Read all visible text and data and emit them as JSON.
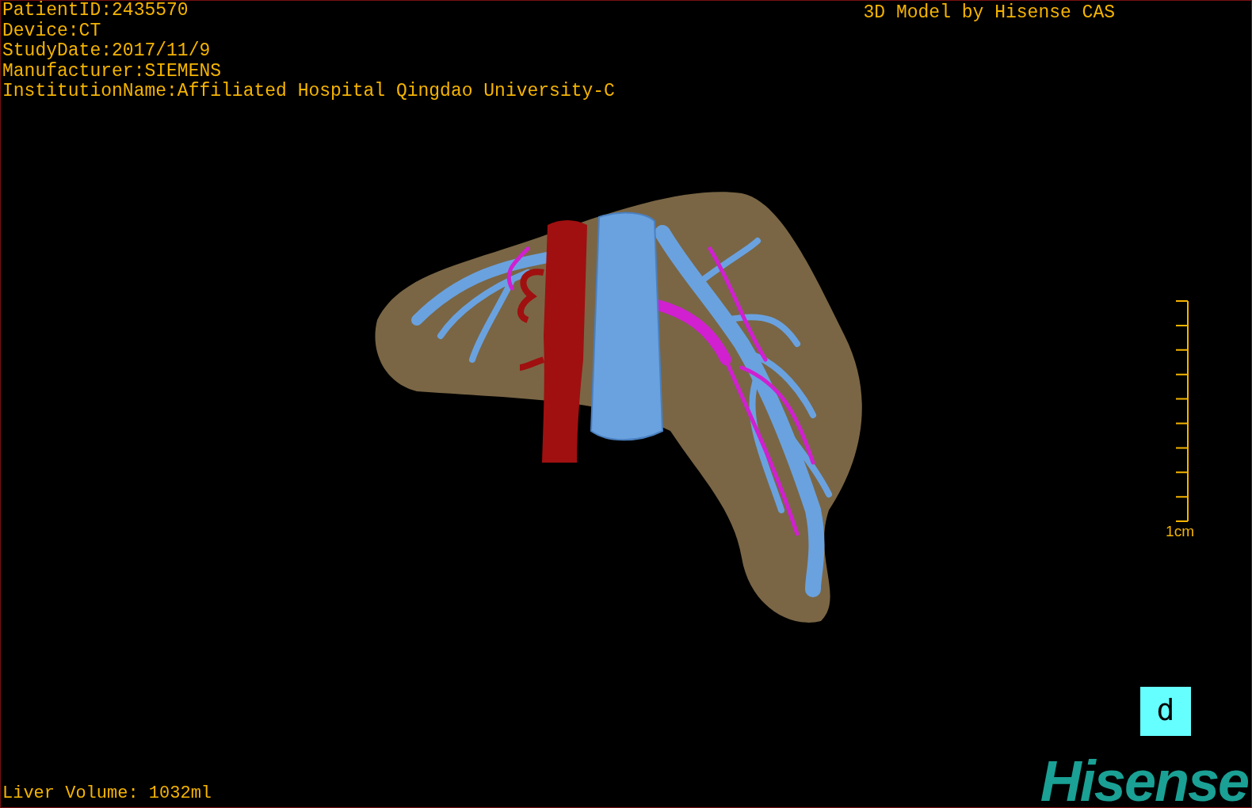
{
  "viewport": {
    "info_lines": [
      "PatientID:2435570",
      "Device:CT",
      "StudyDate:2017/11/9",
      "Manufacturer:SIEMENS",
      "InstitutionName:Affiliated Hospital Qingdao University-C"
    ],
    "title": "3D Model by Hisense CAS",
    "scale_bar": {
      "label": "1cm"
    },
    "orientation_marker": "d",
    "liver_volume": "Liver Volume: 1032ml",
    "logo": "Hisense"
  }
}
